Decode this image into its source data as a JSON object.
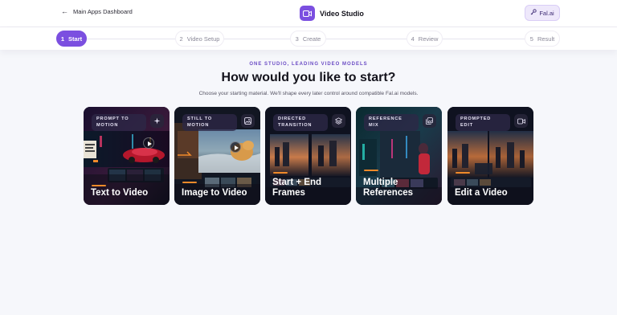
{
  "header": {
    "back_label": "Main Apps Dashboard",
    "title": "Video Studio",
    "account_label": "Fal.ai"
  },
  "steps": [
    {
      "number": "1",
      "label": "Start",
      "active": true
    },
    {
      "number": "2",
      "label": "Video Setup",
      "active": false
    },
    {
      "number": "3",
      "label": "Create",
      "active": false
    },
    {
      "number": "4",
      "label": "Review",
      "active": false
    },
    {
      "number": "5",
      "label": "Result",
      "active": false
    }
  ],
  "intro": {
    "eyebrow": "ONE STUDIO, LEADING VIDEO MODELS",
    "headline": "How would you like to start?",
    "subtext": "Choose your starting material. We'll shape every later control around compatible Fal.ai models."
  },
  "cards": [
    {
      "tag": "PROMPT TO MOTION",
      "title": "Text to Video",
      "icon": "sparkles-icon"
    },
    {
      "tag": "STILL TO MOTION",
      "title": "Image to Video",
      "icon": "image-icon"
    },
    {
      "tag": "DIRECTED TRANSITION",
      "title": "Start + End Frames",
      "icon": "layers-icon"
    },
    {
      "tag": "REFERENCE MIX",
      "title": "Multiple References",
      "icon": "images-icon"
    },
    {
      "tag": "PROMPTED EDIT",
      "title": "Edit a Video",
      "icon": "video-camera-icon"
    }
  ],
  "colors": {
    "accent": "#7b4fe0",
    "card_bg": "#0e0f1a",
    "highlight": "#f08a2a"
  }
}
